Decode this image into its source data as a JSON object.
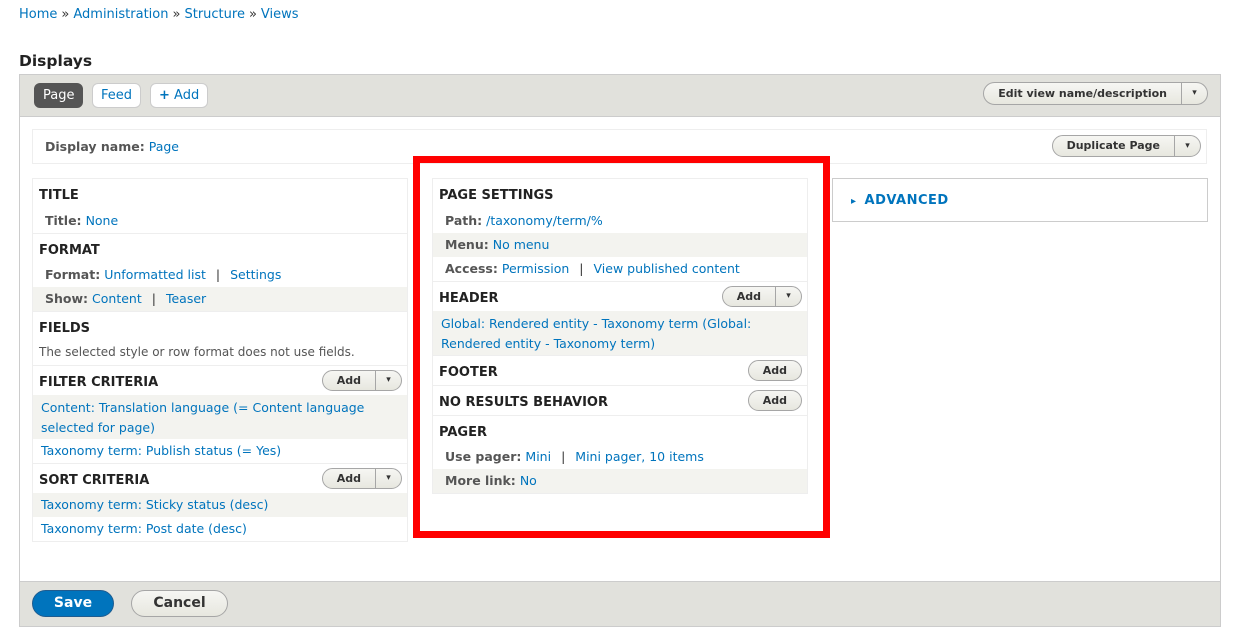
{
  "breadcrumb": [
    "Home",
    "Administration",
    "Structure",
    "Views"
  ],
  "breadcrumb_sep": "»",
  "heading": "Displays",
  "tabs": {
    "page": "Page",
    "feed": "Feed",
    "add": "Add",
    "add_icon": "plus-icon"
  },
  "edit_view": "Edit view name/description",
  "display_name": {
    "label": "Display name:",
    "value": "Page"
  },
  "duplicate": "Duplicate Page",
  "dropdown_icon": "▾",
  "add_label": "Add",
  "left": {
    "title": {
      "header": "TITLE",
      "label": "Title:",
      "value": "None"
    },
    "format": {
      "header": "FORMAT",
      "format_label": "Format:",
      "format_value": "Unformatted list",
      "settings": "Settings",
      "show_label": "Show:",
      "show_value": "Content",
      "teaser": "Teaser"
    },
    "fields": {
      "header": "FIELDS",
      "text": "The selected style or row format does not use fields."
    },
    "filter": {
      "header": "FILTER CRITERIA",
      "items": [
        "Content: Translation language (= Content language selected for page)",
        "Taxonomy term: Publish status (= Yes)"
      ]
    },
    "sort": {
      "header": "SORT CRITERIA",
      "items": [
        "Taxonomy term: Sticky status (desc)",
        "Taxonomy term: Post date (desc)"
      ]
    }
  },
  "middle": {
    "page_settings": {
      "header": "PAGE SETTINGS",
      "path_label": "Path:",
      "path": "/taxonomy/term/%",
      "menu_label": "Menu:",
      "menu": "No menu",
      "access_label": "Access:",
      "access": "Permission",
      "access2": "View published content"
    },
    "header": {
      "header": "HEADER",
      "item": "Global: Rendered entity - Taxonomy term (Global: Rendered entity - Taxonomy term)"
    },
    "footer": {
      "header": "FOOTER"
    },
    "no_results": {
      "header": "NO RESULTS BEHAVIOR"
    },
    "pager": {
      "header": "PAGER",
      "use_label": "Use pager:",
      "use": "Mini",
      "use2": "Mini pager, 10 items",
      "more_label": "More link:",
      "more": "No"
    }
  },
  "advanced": "ADVANCED",
  "advanced_icon": "▸",
  "save": "Save",
  "cancel": "Cancel",
  "colors": {
    "accent": "#0074bd",
    "highlight": "#ff0000"
  }
}
